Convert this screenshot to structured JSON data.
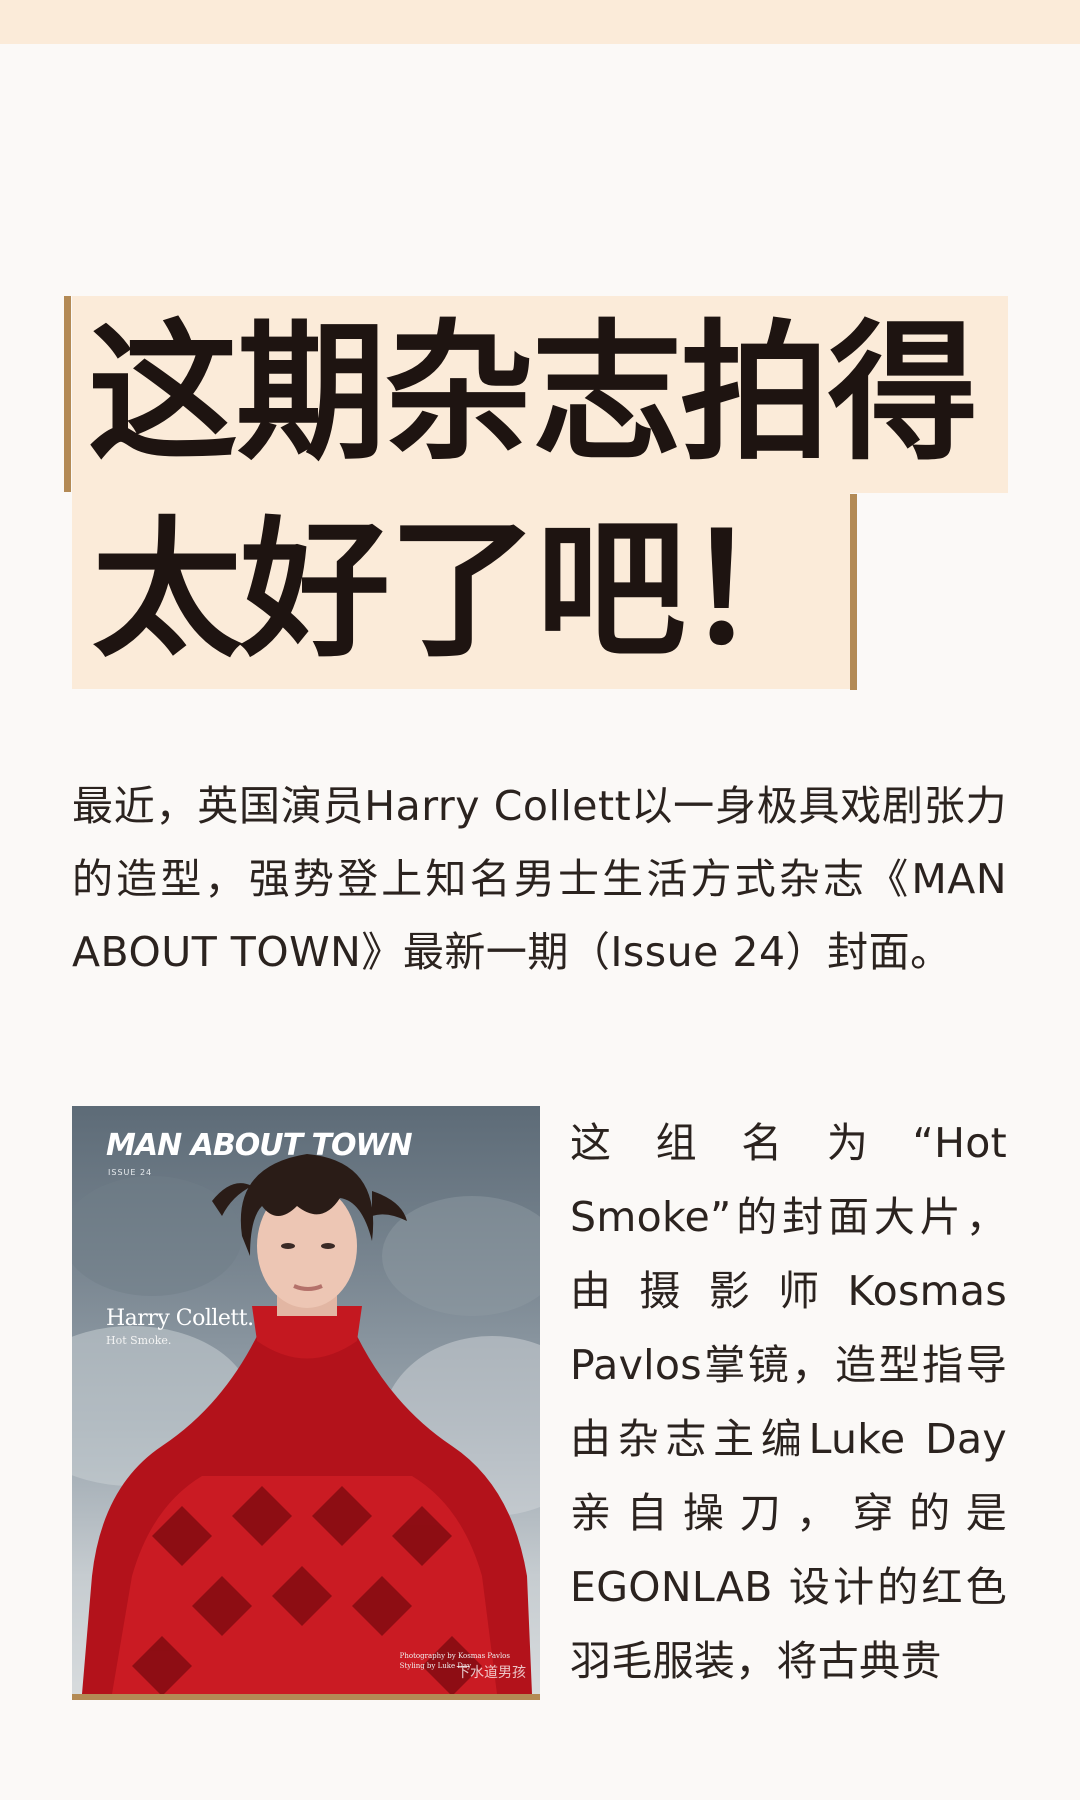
{
  "title": {
    "line1": "这期杂志拍得",
    "line2": "太好了吧！"
  },
  "intro": "最近，英国演员Harry Collett以一身极具戏剧张力的造型，强势登上知名男士生活方式杂志《MAN ABOUT TOWN》最新一期（Issue 24）封面。",
  "cover": {
    "masthead": "MAN ABOUT TOWN",
    "issue": "ISSUE 24",
    "name": "Harry Collett.",
    "subtitle": "Hot Smoke.",
    "credit_line1": "Photography by Kosmas Pavlos",
    "credit_line2": "Styling by Luke Day",
    "watermark": "下水道男孩"
  },
  "side_text": "这组名为“Hot Smoke”的封面大片，由摄影师Kosmas Pavlos掌镜，造型指导由杂志主编Luke Day亲自操刀，穿的是EGONLAB 设计的红色羽毛服装，将古典贵",
  "colors": {
    "title_bg": "#fbebd9",
    "accent_gold": "#b38a55",
    "page_bg": "#fbf9f7",
    "text": "#2b231f"
  }
}
